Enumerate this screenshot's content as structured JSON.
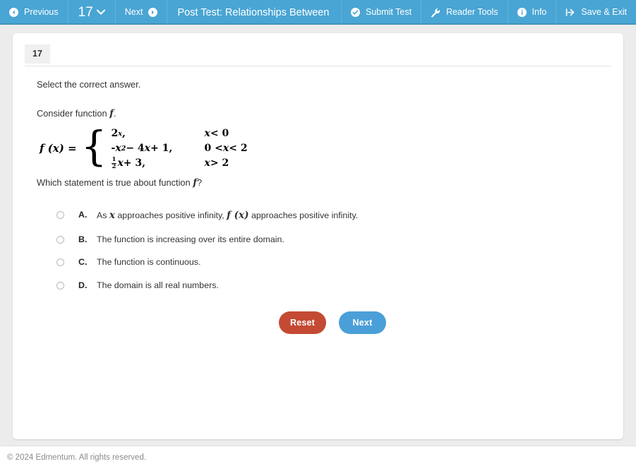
{
  "topbar": {
    "previous_label": "Previous",
    "question_number": "17",
    "next_label": "Next",
    "test_title": "Post Test: Relationships Between Functions",
    "submit_label": "Submit Test",
    "reader_tools_label": "Reader Tools",
    "info_label": "Info",
    "save_exit_label": "Save & Exit",
    "background_color": "#49a5d4"
  },
  "question": {
    "tab_number": "17",
    "prompt": "Select the correct answer.",
    "consider_prefix": "Consider function ",
    "consider_var": "f",
    "consider_suffix": ".",
    "function_lhs": "f (x)  =",
    "pieces": [
      {
        "expr_html": "2<span class=\"sup\">x</span>,",
        "condition_html": "<i>x</i> &lt; 0"
      },
      {
        "expr_html": "-<i>x</i><span class=\"sup\">2</span> &minus; 4<i>x</i> + 1,",
        "condition_html": "0 &lt; <i>x</i> &lt; 2"
      },
      {
        "expr_html": "<span class=\"frac\"><span class=\"num\">1</span><span class=\"den\">2</span></span><i>x</i> + 3,",
        "condition_html": "<i>x</i> &gt; 2"
      }
    ],
    "question_prefix": "Which statement is true about function ",
    "question_var": "f",
    "question_suffix": "?",
    "options": [
      {
        "letter": "A.",
        "text_html": "As <span class=\"mvar\">x</span> approaches positive infinity, <span class=\"mvar\">f (x)</span> approaches positive infinity.",
        "selected": false
      },
      {
        "letter": "B.",
        "text_html": "The function is increasing over its entire domain.",
        "selected": false
      },
      {
        "letter": "C.",
        "text_html": "The function is continuous.",
        "selected": false
      },
      {
        "letter": "D.",
        "text_html": "The domain is all real numbers.",
        "selected": false
      }
    ]
  },
  "actions": {
    "reset_label": "Reset",
    "next_label": "Next",
    "reset_color": "#c44a33",
    "next_color": "#4a9fd8"
  },
  "footer": {
    "copyright": "© 2024 Edmentum. All rights reserved."
  }
}
